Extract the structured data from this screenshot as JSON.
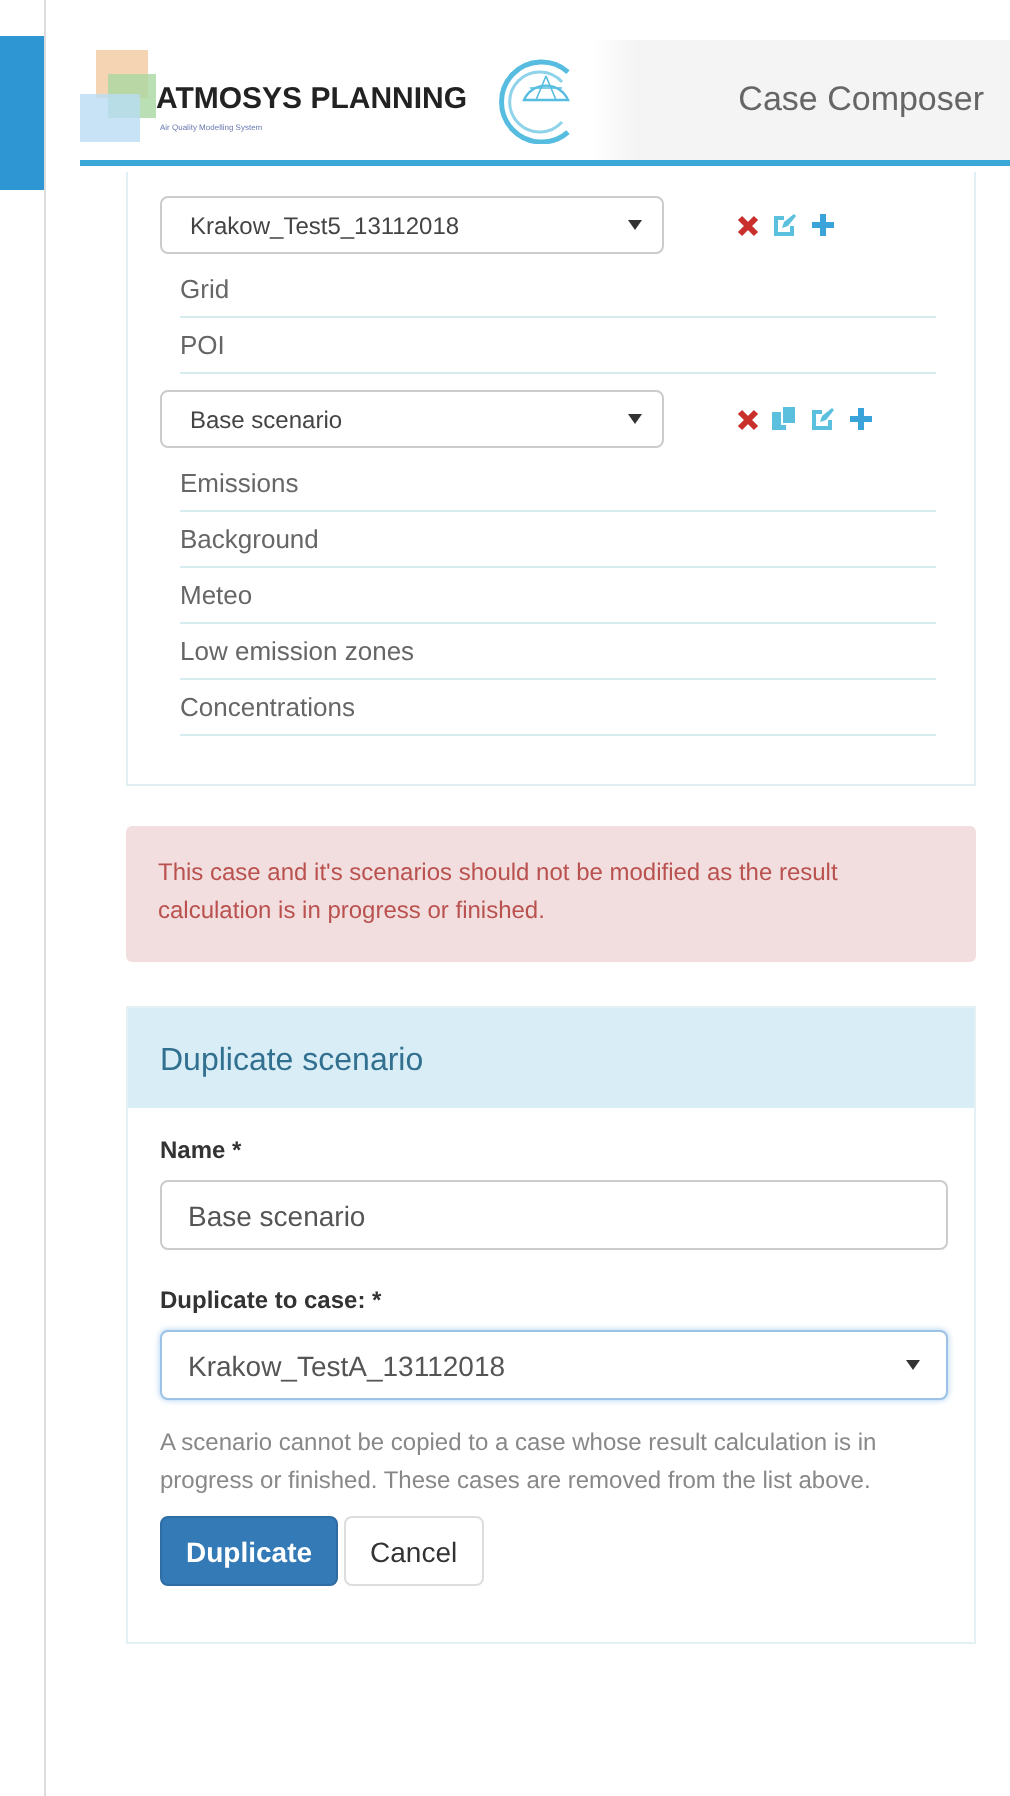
{
  "header": {
    "logo": "ATMOSYS PLANNING",
    "tagline": "Air Quality Modelling System",
    "title": "Case Composer"
  },
  "groups": [
    {
      "select": "Krakow_Test5_13112018",
      "actions": [
        {
          "kind": "delete"
        },
        {
          "kind": "edit"
        },
        {
          "kind": "add"
        }
      ],
      "items": [
        "Grid",
        "POI"
      ]
    },
    {
      "select": "Base scenario",
      "actions": [
        {
          "kind": "delete"
        },
        {
          "kind": "copy"
        },
        {
          "kind": "edit"
        },
        {
          "kind": "add"
        }
      ],
      "items": [
        "Emissions",
        "Background",
        "Meteo",
        "Low emission zones",
        "Concentrations"
      ]
    }
  ],
  "alert": "This case and it's scenarios should not be modified as the result calculation is in progress or finished.",
  "duplicate_panel": {
    "title": "Duplicate scenario",
    "name_label": "Name *",
    "name_value": "Base scenario",
    "case_label": "Duplicate to case: *",
    "case_value": "Krakow_TestA_13112018",
    "help": "A scenario cannot be copied to a case whose result calculation is in progress or finished. These cases are removed from the list above.",
    "buttons": [
      {
        "label": "Duplicate",
        "kind": "primary"
      },
      {
        "label": "Cancel",
        "kind": "default"
      }
    ]
  }
}
